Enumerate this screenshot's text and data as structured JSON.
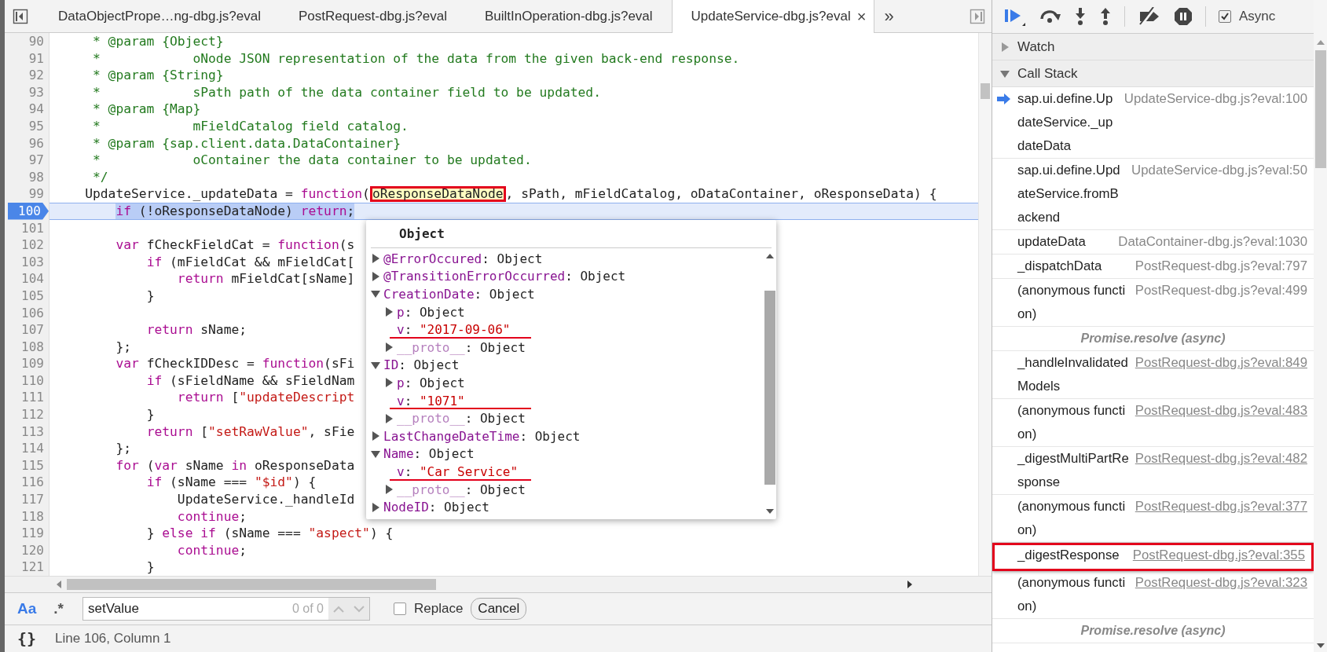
{
  "tabs": [
    {
      "label": "DataObjectPrope…ng-dbg.js?eval",
      "selected": false
    },
    {
      "label": "PostRequest-dbg.js?eval",
      "selected": false
    },
    {
      "label": "BuiltInOperation-dbg.js?eval",
      "selected": false
    },
    {
      "label": "UpdateService-dbg.js?eval",
      "selected": true,
      "close": "×"
    }
  ],
  "tabs_overflow": "»",
  "editor": {
    "lines": [
      {
        "number": "90",
        "current": false,
        "tokens": [
          {
            "kind": "comment",
            "text": "     * @param {Object}"
          }
        ]
      },
      {
        "number": "91",
        "current": false,
        "tokens": [
          {
            "kind": "comment",
            "text": "     *            oNode JSON representation of the data from the given back-end response."
          }
        ]
      },
      {
        "number": "92",
        "current": false,
        "tokens": [
          {
            "kind": "comment",
            "text": "     * @param {String}"
          }
        ]
      },
      {
        "number": "93",
        "current": false,
        "tokens": [
          {
            "kind": "comment",
            "text": "     *            sPath path of the data container field to be updated."
          }
        ]
      },
      {
        "number": "94",
        "current": false,
        "tokens": [
          {
            "kind": "comment",
            "text": "     * @param {Map}"
          }
        ]
      },
      {
        "number": "95",
        "current": false,
        "tokens": [
          {
            "kind": "comment",
            "text": "     *            mFieldCatalog field catalog."
          }
        ]
      },
      {
        "number": "96",
        "current": false,
        "tokens": [
          {
            "kind": "comment",
            "text": "     * @param {sap.client.data.DataContainer}"
          }
        ]
      },
      {
        "number": "97",
        "current": false,
        "tokens": [
          {
            "kind": "comment",
            "text": "     *            oContainer the data container to be updated."
          }
        ]
      },
      {
        "number": "98",
        "current": false,
        "tokens": [
          {
            "kind": "comment",
            "text": "     */"
          }
        ]
      },
      {
        "number": "99",
        "current": false,
        "tokens": [
          {
            "kind": "plain",
            "text": "    UpdateService._updateData = "
          },
          {
            "kind": "keyword",
            "text": "function"
          },
          {
            "kind": "plain",
            "text": "("
          },
          {
            "kind": "hover",
            "text": "oResponseDataNode"
          },
          {
            "kind": "plain",
            "text": ", sPath, mFieldCatalog, oDataContainer, oResponseData) {"
          }
        ]
      },
      {
        "number": "100",
        "current": true,
        "tokens": [
          {
            "kind": "keyword",
            "text": "        if"
          },
          {
            "kind": "plain",
            "text": " (!oResponseDataNode) "
          },
          {
            "kind": "keyword",
            "text": "return"
          },
          {
            "kind": "plain",
            "text": ";"
          }
        ]
      },
      {
        "number": "101",
        "current": false
      },
      {
        "number": "102",
        "current": false,
        "tokens": [
          {
            "kind": "keyword",
            "text": "        var"
          },
          {
            "kind": "plain",
            "text": " fCheckFieldCat = "
          },
          {
            "kind": "keyword",
            "text": "function"
          },
          {
            "kind": "plain",
            "text": "(s"
          }
        ]
      },
      {
        "number": "103",
        "current": false,
        "tokens": [
          {
            "kind": "keyword",
            "text": "            if"
          },
          {
            "kind": "plain",
            "text": " (mFieldCat && mFieldCat["
          }
        ]
      },
      {
        "number": "104",
        "current": false,
        "tokens": [
          {
            "kind": "keyword",
            "text": "                return"
          },
          {
            "kind": "plain",
            "text": " mFieldCat[sName]"
          }
        ]
      },
      {
        "number": "105",
        "current": false,
        "tokens": [
          {
            "kind": "plain",
            "text": "            }"
          }
        ]
      },
      {
        "number": "106",
        "current": false
      },
      {
        "number": "107",
        "current": false,
        "tokens": [
          {
            "kind": "keyword",
            "text": "            return"
          },
          {
            "kind": "plain",
            "text": " sName;"
          }
        ]
      },
      {
        "number": "108",
        "current": false,
        "tokens": [
          {
            "kind": "plain",
            "text": "        };"
          }
        ]
      },
      {
        "number": "109",
        "current": false,
        "tokens": [
          {
            "kind": "keyword",
            "text": "        var"
          },
          {
            "kind": "plain",
            "text": " fCheckIDDesc = "
          },
          {
            "kind": "keyword",
            "text": "function"
          },
          {
            "kind": "plain",
            "text": "(sFi"
          }
        ]
      },
      {
        "number": "110",
        "current": false,
        "tokens": [
          {
            "kind": "keyword",
            "text": "            if"
          },
          {
            "kind": "plain",
            "text": " (sFieldName && sFieldNam"
          }
        ]
      },
      {
        "number": "111",
        "current": false,
        "tokens": [
          {
            "kind": "keyword",
            "text": "                return"
          },
          {
            "kind": "plain",
            "text": " ["
          },
          {
            "kind": "string",
            "text": "\"updateDescript"
          }
        ]
      },
      {
        "number": "112",
        "current": false,
        "tokens": [
          {
            "kind": "plain",
            "text": "            }"
          }
        ]
      },
      {
        "number": "113",
        "current": false,
        "tokens": [
          {
            "kind": "keyword",
            "text": "            return"
          },
          {
            "kind": "plain",
            "text": " ["
          },
          {
            "kind": "string",
            "text": "\"setRawValue\""
          },
          {
            "kind": "plain",
            "text": ", sFie"
          }
        ]
      },
      {
        "number": "114",
        "current": false,
        "tokens": [
          {
            "kind": "plain",
            "text": "        };"
          }
        ]
      },
      {
        "number": "115",
        "current": false,
        "tokens": [
          {
            "kind": "keyword",
            "text": "        for"
          },
          {
            "kind": "plain",
            "text": " ("
          },
          {
            "kind": "keyword",
            "text": "var"
          },
          {
            "kind": "plain",
            "text": " sName "
          },
          {
            "kind": "keyword",
            "text": "in"
          },
          {
            "kind": "plain",
            "text": " oResponseData"
          }
        ]
      },
      {
        "number": "116",
        "current": false,
        "tokens": [
          {
            "kind": "keyword",
            "text": "            if"
          },
          {
            "kind": "plain",
            "text": " (sName === "
          },
          {
            "kind": "string",
            "text": "\"$id\""
          },
          {
            "kind": "plain",
            "text": ") {"
          }
        ]
      },
      {
        "number": "117",
        "current": false,
        "tokens": [
          {
            "kind": "plain",
            "text": "                UpdateService._handleId"
          }
        ]
      },
      {
        "number": "118",
        "current": false,
        "tokens": [
          {
            "kind": "keyword",
            "text": "                continue"
          },
          {
            "kind": "plain",
            "text": ";"
          }
        ]
      },
      {
        "number": "119",
        "current": false,
        "tokens": [
          {
            "kind": "plain",
            "text": "            } "
          },
          {
            "kind": "keyword",
            "text": "else if"
          },
          {
            "kind": "plain",
            "text": " (sName === "
          },
          {
            "kind": "string",
            "text": "\"aspect\""
          },
          {
            "kind": "plain",
            "text": ") {"
          }
        ]
      },
      {
        "number": "120",
        "current": false,
        "tokens": [
          {
            "kind": "keyword",
            "text": "                continue"
          },
          {
            "kind": "plain",
            "text": ";"
          }
        ]
      },
      {
        "number": "121",
        "current": false,
        "tokens": [
          {
            "kind": "plain",
            "text": "            }"
          }
        ]
      }
    ]
  },
  "popup": {
    "title": "Object",
    "rows": [
      {
        "key": "@ErrorOccured:",
        "value": "Object",
        "kind": "object",
        "expanded": false,
        "underlined": false
      },
      {
        "key": "@TransitionErrorOccurred:",
        "value": "Object",
        "kind": "object",
        "expanded": false,
        "underlined": false
      },
      {
        "key": "CreationDate:",
        "value": "Object",
        "kind": "object",
        "expanded": true,
        "underlined": false,
        "children": [
          {
            "key": "p:",
            "value": "Object",
            "kind": "object",
            "expanded": false,
            "underlined": false
          },
          {
            "key": "v:",
            "value": "\"2017-09-06\"",
            "kind": "string",
            "underlined": true
          },
          {
            "key": "__proto__:",
            "value": "Object",
            "kind": "proto",
            "expanded": false,
            "underlined": false
          }
        ]
      },
      {
        "key": "ID:",
        "value": "Object",
        "kind": "object",
        "expanded": true,
        "underlined": false,
        "children": [
          {
            "key": "p:",
            "value": "Object",
            "kind": "object",
            "expanded": false,
            "underlined": false
          },
          {
            "key": "v:",
            "value": "\"1071\"",
            "kind": "string",
            "underlined": true
          },
          {
            "key": "__proto__:",
            "value": "Object",
            "kind": "proto",
            "expanded": false,
            "underlined": false
          }
        ]
      },
      {
        "key": "LastChangeDateTime:",
        "value": "Object",
        "kind": "object",
        "expanded": false,
        "underlined": false
      },
      {
        "key": "Name:",
        "value": "Object",
        "kind": "object",
        "expanded": true,
        "underlined": false,
        "children": [
          {
            "key": "v:",
            "value": "\"Car Service\"",
            "kind": "string",
            "underlined": true
          },
          {
            "key": "__proto__:",
            "value": "Object",
            "kind": "proto",
            "expanded": false,
            "underlined": false
          }
        ]
      },
      {
        "key": "NodeID:",
        "value": "Object",
        "kind": "object",
        "expanded": false,
        "underlined": false
      }
    ]
  },
  "find_bar": {
    "case_toggle": {
      "label": "Aa",
      "on": true
    },
    "regex_toggle": {
      "label": ".*",
      "on": false
    },
    "search": {
      "value": "setValue"
    },
    "match_count": "0 of 0",
    "replace": {
      "label": "Replace",
      "checked": false
    },
    "cancel": "Cancel"
  },
  "status_bar": {
    "format_glyph": "{}",
    "position": "Line 106, Column 1"
  },
  "debugger": {
    "async": {
      "label": "Async",
      "checked": true
    },
    "sections": [
      {
        "title": "Watch",
        "expanded": false
      },
      {
        "title": "Call Stack",
        "expanded": true
      }
    ],
    "call_stack": [
      {
        "kind": "frame",
        "name": "sap.ui.define.UpdateService._updateData",
        "location": "UpdateService-dbg.js?eval:100",
        "current": true,
        "linked": false,
        "boxed": false
      },
      {
        "kind": "frame",
        "name": "sap.ui.define.UpdateService.fromBackend",
        "location": "UpdateService-dbg.js?eval:50",
        "current": false,
        "linked": false,
        "boxed": false
      },
      {
        "kind": "frame",
        "name": "updateData",
        "location": "DataContainer-dbg.js?eval:1030",
        "current": false,
        "linked": false,
        "boxed": false
      },
      {
        "kind": "frame",
        "name": "_dispatchData",
        "location": "PostRequest-dbg.js?eval:797",
        "current": false,
        "linked": false,
        "boxed": false
      },
      {
        "kind": "frame",
        "name": "(anonymous function)",
        "location": "PostRequest-dbg.js?eval:499",
        "current": false,
        "linked": false,
        "boxed": false
      },
      {
        "kind": "async",
        "label": "Promise.resolve (async)"
      },
      {
        "kind": "frame",
        "name": "_handleInvalidatedModels",
        "location": "PostRequest-dbg.js?eval:849",
        "current": false,
        "linked": true,
        "boxed": false
      },
      {
        "kind": "frame",
        "name": "(anonymous function)",
        "location": "PostRequest-dbg.js?eval:483",
        "current": false,
        "linked": true,
        "boxed": false
      },
      {
        "kind": "frame",
        "name": "_digestMultiPartResponse",
        "location": "PostRequest-dbg.js?eval:482",
        "current": false,
        "linked": true,
        "boxed": false
      },
      {
        "kind": "frame",
        "name": "(anonymous function)",
        "location": "PostRequest-dbg.js?eval:377",
        "current": false,
        "linked": true,
        "boxed": false
      },
      {
        "kind": "frame",
        "name": "_digestResponse",
        "location": "PostRequest-dbg.js?eval:355",
        "current": false,
        "linked": true,
        "boxed": true
      },
      {
        "kind": "frame",
        "name": "(anonymous function)",
        "location": "PostRequest-dbg.js?eval:323",
        "current": false,
        "linked": true,
        "boxed": false
      },
      {
        "kind": "async",
        "label": "Promise.resolve (async)"
      }
    ]
  }
}
